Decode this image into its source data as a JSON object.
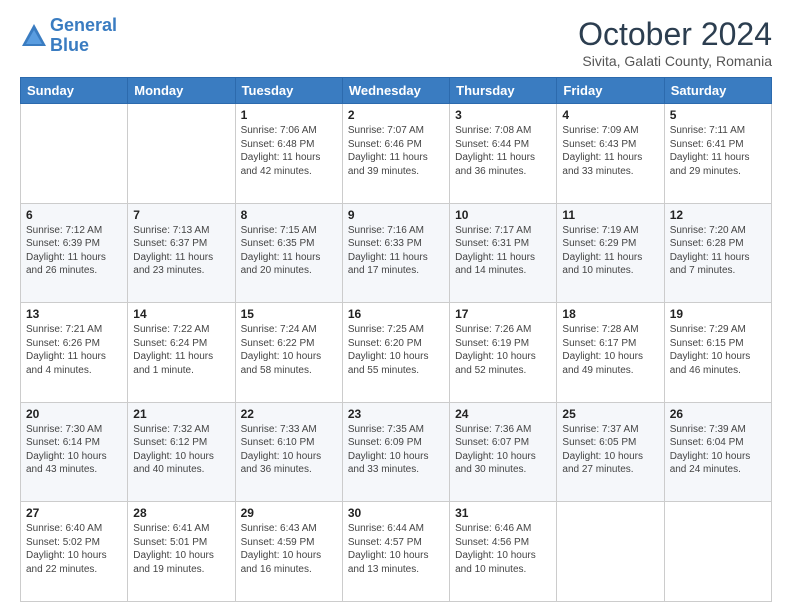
{
  "header": {
    "logo_line1": "General",
    "logo_line2": "Blue",
    "title": "October 2024",
    "subtitle": "Sivita, Galati County, Romania"
  },
  "weekdays": [
    "Sunday",
    "Monday",
    "Tuesday",
    "Wednesday",
    "Thursday",
    "Friday",
    "Saturday"
  ],
  "weeks": [
    [
      {
        "day": "",
        "detail": ""
      },
      {
        "day": "",
        "detail": ""
      },
      {
        "day": "1",
        "detail": "Sunrise: 7:06 AM\nSunset: 6:48 PM\nDaylight: 11 hours and 42 minutes."
      },
      {
        "day": "2",
        "detail": "Sunrise: 7:07 AM\nSunset: 6:46 PM\nDaylight: 11 hours and 39 minutes."
      },
      {
        "day": "3",
        "detail": "Sunrise: 7:08 AM\nSunset: 6:44 PM\nDaylight: 11 hours and 36 minutes."
      },
      {
        "day": "4",
        "detail": "Sunrise: 7:09 AM\nSunset: 6:43 PM\nDaylight: 11 hours and 33 minutes."
      },
      {
        "day": "5",
        "detail": "Sunrise: 7:11 AM\nSunset: 6:41 PM\nDaylight: 11 hours and 29 minutes."
      }
    ],
    [
      {
        "day": "6",
        "detail": "Sunrise: 7:12 AM\nSunset: 6:39 PM\nDaylight: 11 hours and 26 minutes."
      },
      {
        "day": "7",
        "detail": "Sunrise: 7:13 AM\nSunset: 6:37 PM\nDaylight: 11 hours and 23 minutes."
      },
      {
        "day": "8",
        "detail": "Sunrise: 7:15 AM\nSunset: 6:35 PM\nDaylight: 11 hours and 20 minutes."
      },
      {
        "day": "9",
        "detail": "Sunrise: 7:16 AM\nSunset: 6:33 PM\nDaylight: 11 hours and 17 minutes."
      },
      {
        "day": "10",
        "detail": "Sunrise: 7:17 AM\nSunset: 6:31 PM\nDaylight: 11 hours and 14 minutes."
      },
      {
        "day": "11",
        "detail": "Sunrise: 7:19 AM\nSunset: 6:29 PM\nDaylight: 11 hours and 10 minutes."
      },
      {
        "day": "12",
        "detail": "Sunrise: 7:20 AM\nSunset: 6:28 PM\nDaylight: 11 hours and 7 minutes."
      }
    ],
    [
      {
        "day": "13",
        "detail": "Sunrise: 7:21 AM\nSunset: 6:26 PM\nDaylight: 11 hours and 4 minutes."
      },
      {
        "day": "14",
        "detail": "Sunrise: 7:22 AM\nSunset: 6:24 PM\nDaylight: 11 hours and 1 minute."
      },
      {
        "day": "15",
        "detail": "Sunrise: 7:24 AM\nSunset: 6:22 PM\nDaylight: 10 hours and 58 minutes."
      },
      {
        "day": "16",
        "detail": "Sunrise: 7:25 AM\nSunset: 6:20 PM\nDaylight: 10 hours and 55 minutes."
      },
      {
        "day": "17",
        "detail": "Sunrise: 7:26 AM\nSunset: 6:19 PM\nDaylight: 10 hours and 52 minutes."
      },
      {
        "day": "18",
        "detail": "Sunrise: 7:28 AM\nSunset: 6:17 PM\nDaylight: 10 hours and 49 minutes."
      },
      {
        "day": "19",
        "detail": "Sunrise: 7:29 AM\nSunset: 6:15 PM\nDaylight: 10 hours and 46 minutes."
      }
    ],
    [
      {
        "day": "20",
        "detail": "Sunrise: 7:30 AM\nSunset: 6:14 PM\nDaylight: 10 hours and 43 minutes."
      },
      {
        "day": "21",
        "detail": "Sunrise: 7:32 AM\nSunset: 6:12 PM\nDaylight: 10 hours and 40 minutes."
      },
      {
        "day": "22",
        "detail": "Sunrise: 7:33 AM\nSunset: 6:10 PM\nDaylight: 10 hours and 36 minutes."
      },
      {
        "day": "23",
        "detail": "Sunrise: 7:35 AM\nSunset: 6:09 PM\nDaylight: 10 hours and 33 minutes."
      },
      {
        "day": "24",
        "detail": "Sunrise: 7:36 AM\nSunset: 6:07 PM\nDaylight: 10 hours and 30 minutes."
      },
      {
        "day": "25",
        "detail": "Sunrise: 7:37 AM\nSunset: 6:05 PM\nDaylight: 10 hours and 27 minutes."
      },
      {
        "day": "26",
        "detail": "Sunrise: 7:39 AM\nSunset: 6:04 PM\nDaylight: 10 hours and 24 minutes."
      }
    ],
    [
      {
        "day": "27",
        "detail": "Sunrise: 6:40 AM\nSunset: 5:02 PM\nDaylight: 10 hours and 22 minutes."
      },
      {
        "day": "28",
        "detail": "Sunrise: 6:41 AM\nSunset: 5:01 PM\nDaylight: 10 hours and 19 minutes."
      },
      {
        "day": "29",
        "detail": "Sunrise: 6:43 AM\nSunset: 4:59 PM\nDaylight: 10 hours and 16 minutes."
      },
      {
        "day": "30",
        "detail": "Sunrise: 6:44 AM\nSunset: 4:57 PM\nDaylight: 10 hours and 13 minutes."
      },
      {
        "day": "31",
        "detail": "Sunrise: 6:46 AM\nSunset: 4:56 PM\nDaylight: 10 hours and 10 minutes."
      },
      {
        "day": "",
        "detail": ""
      },
      {
        "day": "",
        "detail": ""
      }
    ]
  ]
}
